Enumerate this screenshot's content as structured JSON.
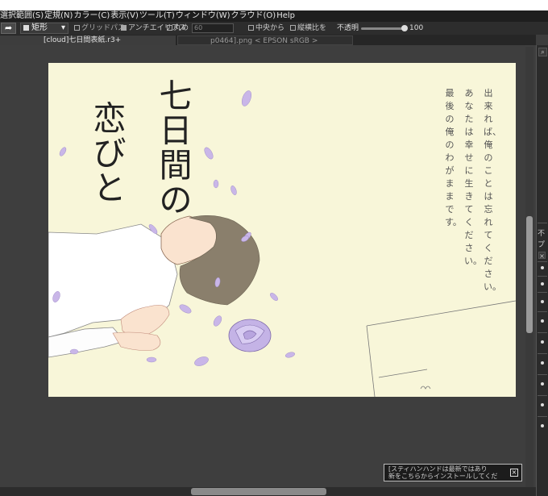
{
  "menu": [
    "選択範囲(S)",
    "定規(N)",
    "カラー(C)",
    "表示(V)",
    "ツール(T)",
    "ウィンドウ(W)",
    "クラウド(O)",
    "Help"
  ],
  "toolbar": {
    "redo_icon": "redo-arrow-icon",
    "shape_label": "矩形",
    "gridpass_label": "グリッドパス",
    "antialias_label": "アンチエイリアス",
    "round_label": "丸め",
    "round_value": "60",
    "center_label": "中央から",
    "ratio_label": "縦横比を",
    "opacity_label": "不透明",
    "opacity_value": "100",
    "opacity_fraction": 1.0
  },
  "tabs": [
    {
      "label": "[cloud]七日間表紙.r3+",
      "active": true
    },
    {
      "label": "p0464].png < EPSON  sRGB >",
      "active": false
    }
  ],
  "artwork": {
    "title_col1": "七日間の",
    "title_col2": "恋びと",
    "quote_col1": "出来れば、俺のことは忘れてください。",
    "quote_col2": "あなたは幸せに生きてください。",
    "quote_col3": "最後の俺のわがままです。"
  },
  "right_panel": {
    "zoom_icon": "zoom-icon",
    "label1": "不",
    "label2": "プ",
    "close_icon": "close-icon"
  },
  "notification": {
    "line1": "[スティハンハンドは最新ではあり",
    "line2": "新をこちらからインストールしてくだ",
    "close_icon": "close-icon"
  },
  "colors": {
    "sheet": "#f8f6d9",
    "petal": "#c9b6e8",
    "hair": "#8a7f6c"
  }
}
